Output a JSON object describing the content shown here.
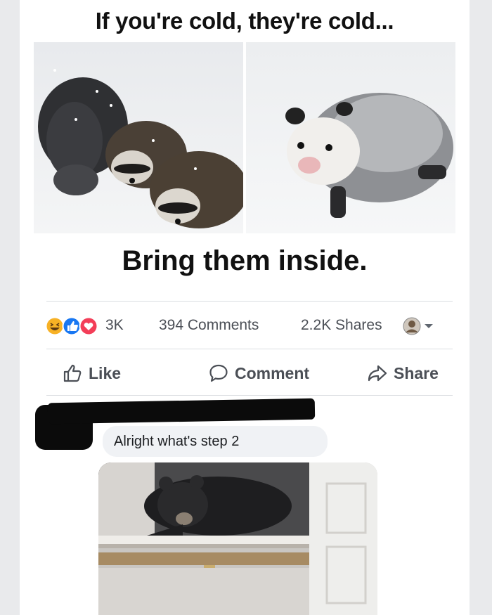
{
  "meme": {
    "top_caption": "If you're cold, they're cold...",
    "bottom_caption": "Bring them inside."
  },
  "post_stats": {
    "reaction_icons": [
      "haha-icon",
      "like-icon",
      "love-icon"
    ],
    "reaction_count": "3K",
    "comments": "394 Comments",
    "shares": "2.2K Shares"
  },
  "actions": {
    "like_label": "Like",
    "comment_label": "Comment",
    "share_label": "Share"
  },
  "comment": {
    "text": "Alright what's step 2"
  },
  "colors": {
    "facebook_blue": "#1877f2",
    "love_red": "#f33e58",
    "haha_yellow": "#f7b125",
    "text_gray": "#4b4f56",
    "bubble_gray": "#f0f2f5"
  }
}
